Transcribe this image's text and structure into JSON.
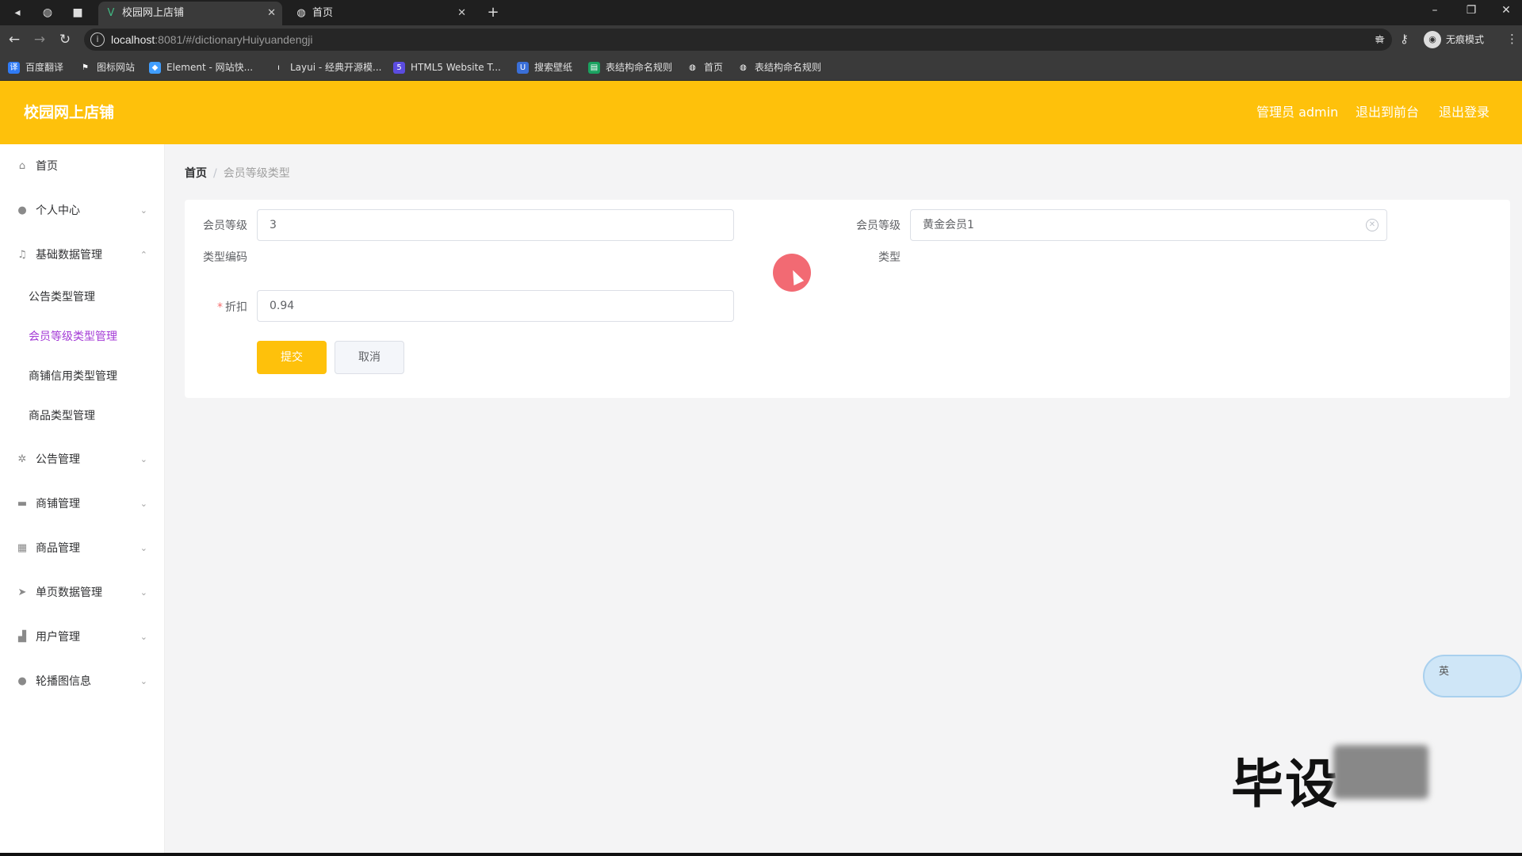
{
  "browser": {
    "tabs": [
      {
        "label": "校园网上店铺",
        "active": true
      },
      {
        "label": "首页",
        "active": false
      }
    ],
    "url_host": "localhost",
    "url_rest": ":8081/#/dictionaryHuiyuandengji",
    "profile_label": "无痕模式",
    "bookmarks": [
      "百度翻译",
      "图标网站",
      "Element - 网站快...",
      "Layui - 经典开源模...",
      "HTML5 Website T...",
      "搜索壁纸",
      "表结构命名规则",
      "首页",
      "表结构命名规则"
    ]
  },
  "header": {
    "title": "校园网上店铺",
    "admin_label": "管理员 admin",
    "to_front": "退出到前台",
    "logout": "退出登录"
  },
  "sidebar": {
    "items": [
      {
        "label": "首页",
        "icon": "home-icon"
      },
      {
        "label": "个人中心",
        "icon": "user-icon"
      },
      {
        "label": "基础数据管理",
        "icon": "mic-icon"
      },
      {
        "label": "公告管理",
        "icon": "compass-icon"
      },
      {
        "label": "商铺管理",
        "icon": "chat-icon"
      },
      {
        "label": "商品管理",
        "icon": "grid-icon"
      },
      {
        "label": "单页数据管理",
        "icon": "send-icon"
      },
      {
        "label": "用户管理",
        "icon": "thumb-icon"
      },
      {
        "label": "轮播图信息",
        "icon": "pin-icon"
      }
    ],
    "sub_items": [
      "公告类型管理",
      "会员等级类型管理",
      "商铺信用类型管理",
      "商品类型管理"
    ],
    "active_sub": "会员等级类型管理"
  },
  "breadcrumb": {
    "home": "首页",
    "separator": "/",
    "current": "会员等级类型"
  },
  "form": {
    "level_code_label_1": "会员等级",
    "level_code_label_2": "类型编码",
    "level_code_value": "3",
    "level_type_label_1": "会员等级",
    "level_type_label_2": "类型",
    "level_type_value": "黄金会员1",
    "discount_label": "折扣",
    "discount_value": "0.94",
    "submit_label": "提交",
    "cancel_label": "取消"
  },
  "ime": {
    "label": "英"
  },
  "watermark": {
    "text": "毕设"
  }
}
